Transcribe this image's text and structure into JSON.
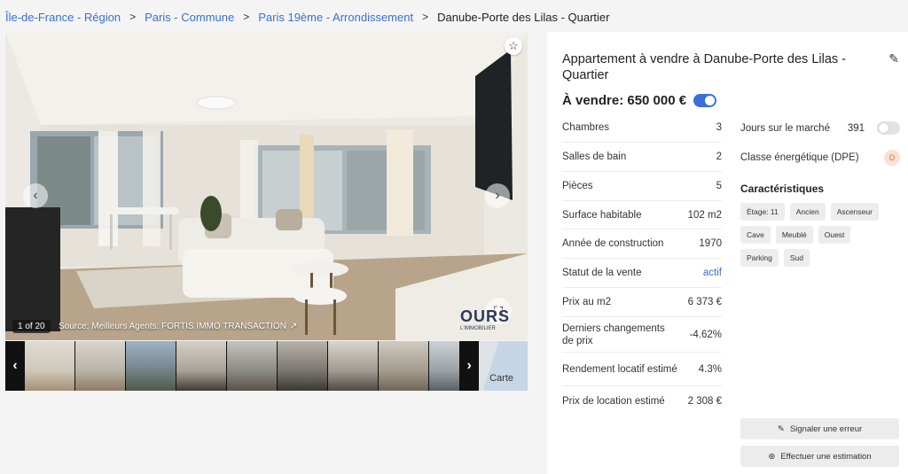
{
  "breadcrumb": {
    "items": [
      {
        "label": "Île-de-France - Région"
      },
      {
        "label": "Paris - Commune"
      },
      {
        "label": "Paris 19ème - Arrondissement"
      }
    ],
    "current": "Danube-Porte des Lilas - Quartier",
    "separator": ">"
  },
  "gallery": {
    "counter": "1 of 20",
    "source": "Source: Meilleurs Agents: FORTIS IMMO TRANSACTION",
    "watermark": "OURS",
    "watermark_sub": "L'IMMOBILIER",
    "map_label": "Carte",
    "icons": {
      "favorite": "star-icon",
      "prev": "chevron-left-icon",
      "next": "chevron-right-icon",
      "expand": "expand-icon",
      "external": "external-link-icon"
    }
  },
  "listing": {
    "title": "Appartement à vendre à Danube-Porte des Lilas - Quartier",
    "price_label": "À vendre: 650 000 €",
    "sale_toggle_on": true,
    "stats": [
      {
        "label": "Chambres",
        "value": "3"
      },
      {
        "label": "Salles de bain",
        "value": "2"
      },
      {
        "label": "Pièces",
        "value": "5"
      },
      {
        "label": "Surface habitable",
        "value": "102 m2"
      },
      {
        "label": "Année de construction",
        "value": "1970"
      },
      {
        "label": "Statut de la vente",
        "value": "actif"
      },
      {
        "label": "Prix au m2",
        "value": "6 373 €"
      },
      {
        "label": "Derniers changements de prix",
        "value": "-4.62%"
      },
      {
        "label": "Rendement locatif estimé",
        "value": "4.3%"
      },
      {
        "label": "Prix de location estimé",
        "value": "2 308 €"
      }
    ],
    "days_on_market_label": "Jours sur le marché",
    "days_on_market_value": "391",
    "days_toggle_on": false,
    "energy_label": "Classe énergétique (DPE)",
    "energy_value": "D",
    "features_title": "Caractéristiques",
    "features": [
      "Étage: 11",
      "Ancien",
      "Ascenseur",
      "Cave",
      "Meublé",
      "Ouest",
      "Parking",
      "Sud"
    ],
    "report_error_label": "Signaler une erreur",
    "estimate_label": "Effectuer une estimation"
  },
  "colors": {
    "link": "#3a6fd8",
    "toggle_on": "#3a6fd8",
    "dpe_bg": "#fbe0d3",
    "dpe_text": "#d2743f"
  }
}
